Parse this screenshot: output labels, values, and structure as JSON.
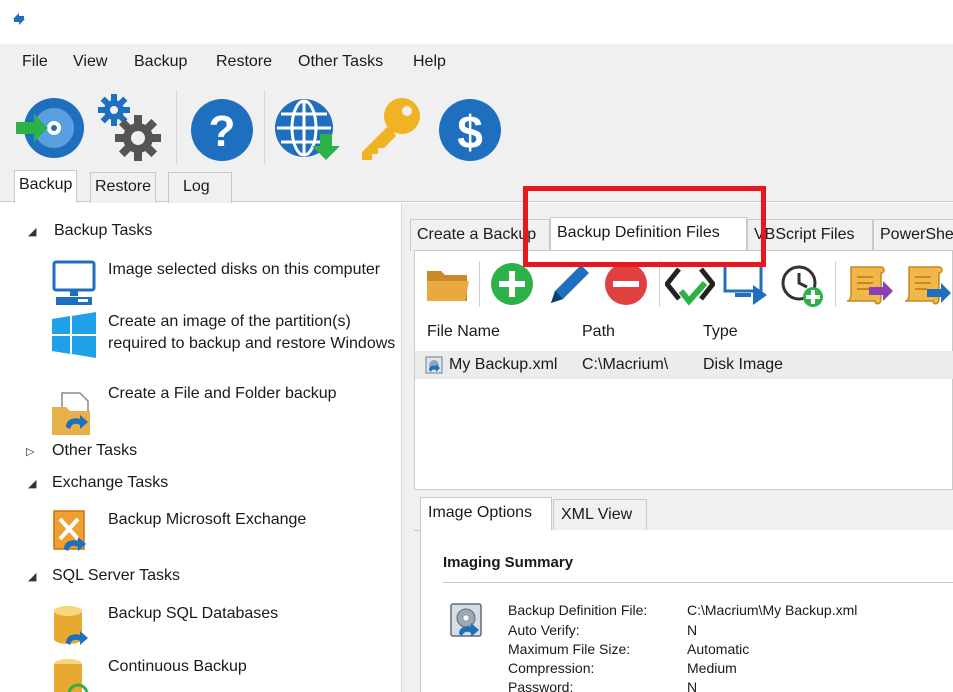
{
  "menu": [
    "File",
    "View",
    "Backup",
    "Restore",
    "Other Tasks",
    "Help"
  ],
  "toolbar": {
    "icons": [
      "disk-backup-icon",
      "settings-gears-icon",
      "help-icon",
      "web-download-icon",
      "key-icon",
      "dollar-icon"
    ]
  },
  "main_tabs": [
    "Backup",
    "Restore",
    "Log"
  ],
  "left": {
    "backup_tasks_header": "Backup Tasks",
    "tasks": [
      {
        "label": "Image selected disks on this computer",
        "icon": "monitor-icon"
      },
      {
        "label": "Create an image of the partition(s) required to backup and restore Windows",
        "icon": "windows-logo-icon"
      },
      {
        "label": "Create a File and Folder backup",
        "icon": "folder-backup-icon"
      }
    ],
    "other_tasks_header": "Other Tasks",
    "exchange_header": "Exchange Tasks",
    "exchange_task": "Backup Microsoft Exchange",
    "sql_header": "SQL Server Tasks",
    "sql_tasks": [
      "Backup SQL Databases",
      "Continuous Backup"
    ]
  },
  "sub_tabs": [
    "Create a Backup",
    "Backup Definition Files",
    "VBScript Files",
    "PowerShe"
  ],
  "list": {
    "toolbar_icons": [
      "open-folder-icon",
      "add-icon",
      "edit-pencil-icon",
      "remove-icon",
      "xml-check-icon",
      "monitor-run-icon",
      "schedule-add-icon",
      "script-vbs-icon",
      "script-ps-icon"
    ],
    "columns": [
      "File Name",
      "Path",
      "Type"
    ],
    "rows": [
      {
        "name": "My Backup.xml",
        "path": "C:\\Macrium\\",
        "type": "Disk Image"
      }
    ]
  },
  "bottom_tabs": [
    "Image Options",
    "XML View"
  ],
  "summary": {
    "title": "Imaging Summary",
    "labels": [
      "Backup Definition File:",
      "Auto Verify:",
      "Maximum File Size:",
      "Compression:",
      "Password:"
    ],
    "values": [
      "C:\\Macrium\\My Backup.xml",
      "N",
      "Automatic",
      "Medium",
      "N"
    ]
  },
  "colors": {
    "highlight": "#e8161f",
    "accent_blue": "#1f6fbf"
  }
}
